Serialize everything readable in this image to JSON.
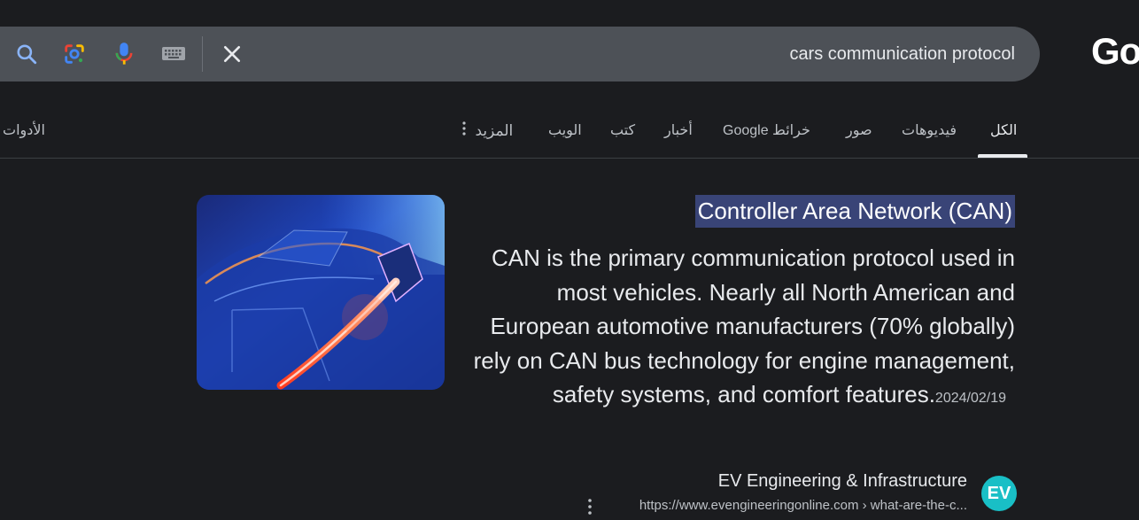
{
  "search": {
    "query": "cars communication protocol",
    "logo_text": "Go"
  },
  "tabs": [
    {
      "label": "الكل",
      "active": true
    },
    {
      "label": "فيديوهات"
    },
    {
      "label": "صور"
    },
    {
      "label": "خرائط Google"
    },
    {
      "label": "أخبار"
    },
    {
      "label": "كتب"
    },
    {
      "label": "الويب"
    },
    {
      "label": "المزيد"
    }
  ],
  "tools_label": "الأدوات",
  "result": {
    "title": "Controller Area Network (CAN)",
    "snippet": "CAN is the primary communication protocol used in most vehicles. Nearly all North American and European automotive manufacturers (70% globally) rely on CAN bus technology for engine management, safety systems, and comfort features.",
    "date": "2024/02/19",
    "source_name": "EV Engineering & Infrastructure",
    "source_url": "https://www.evengineeringonline.com › what-are-the-c...",
    "favicon_text": "EV"
  },
  "colors": {
    "background": "#1b1c1f",
    "searchbar": "#4d5157",
    "highlight": "#394477",
    "favicon": "#19bfc6"
  }
}
